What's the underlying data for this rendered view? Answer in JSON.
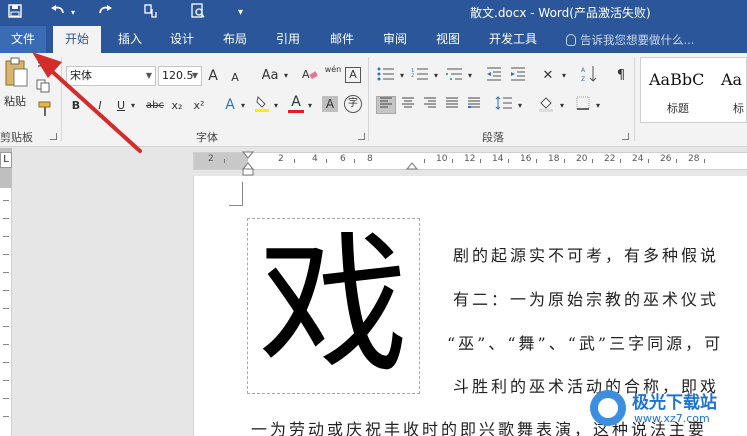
{
  "window": {
    "title": "散文.docx - Word(产品激活失败)"
  },
  "quick_access": {
    "save_icon": "save-icon",
    "undo_icon": "undo-icon",
    "redo_icon": "redo-icon",
    "touch_icon": "touch-mode-icon",
    "preview_icon": "print-preview-icon",
    "customize_icon": "customize-qat-icon"
  },
  "tabs": [
    {
      "label": "文件"
    },
    {
      "label": "开始"
    },
    {
      "label": "插入"
    },
    {
      "label": "设计"
    },
    {
      "label": "布局"
    },
    {
      "label": "引用"
    },
    {
      "label": "邮件"
    },
    {
      "label": "审阅"
    },
    {
      "label": "视图"
    },
    {
      "label": "开发工具"
    }
  ],
  "tell_me": {
    "placeholder": "告诉我您想要做什么..."
  },
  "ribbon": {
    "clipboard": {
      "paste_label": "粘贴",
      "group_label": "剪贴板"
    },
    "font": {
      "font_name": "宋体",
      "font_size": "120.5",
      "grow_label": "A",
      "shrink_label": "A",
      "case_label": "Aa",
      "phonetic_label": "wén",
      "border_char": "A",
      "bold": "B",
      "italic": "I",
      "underline": "U",
      "strike": "abc",
      "subscript": "x₂",
      "superscript": "x²",
      "effects": "A",
      "font_color": "A",
      "char_shade": "A",
      "enclose": "字",
      "group_label": "字体"
    },
    "paragraph": {
      "group_label": "段落"
    },
    "styles": {
      "items": [
        {
          "preview": "AaBbC",
          "label": "标题"
        },
        {
          "preview": "Aa",
          "label": "标"
        }
      ]
    }
  },
  "ruler": {
    "numbers": [
      "2",
      "2",
      "4",
      "6",
      "8",
      "10",
      "12",
      "14",
      "16",
      "18",
      "20",
      "22",
      "24",
      "26",
      "28"
    ]
  },
  "document": {
    "big_char": "戏",
    "lines": [
      "剧的起源实不可考，有多种假说",
      "有二：一为原始宗教的巫术仪式",
      "“巫”、“舞”、“武”三字同源，可",
      "斗胜利的巫术活动的合称，即戏",
      "一为劳动或庆祝丰收时的即兴歌舞表演，这种说法主要"
    ]
  },
  "watermark": {
    "line1": "极光下载站",
    "line2": "www.xz7.com"
  },
  "colors": {
    "title_bar": "#2b579a",
    "annotation_arrow": "#d42b2b"
  }
}
